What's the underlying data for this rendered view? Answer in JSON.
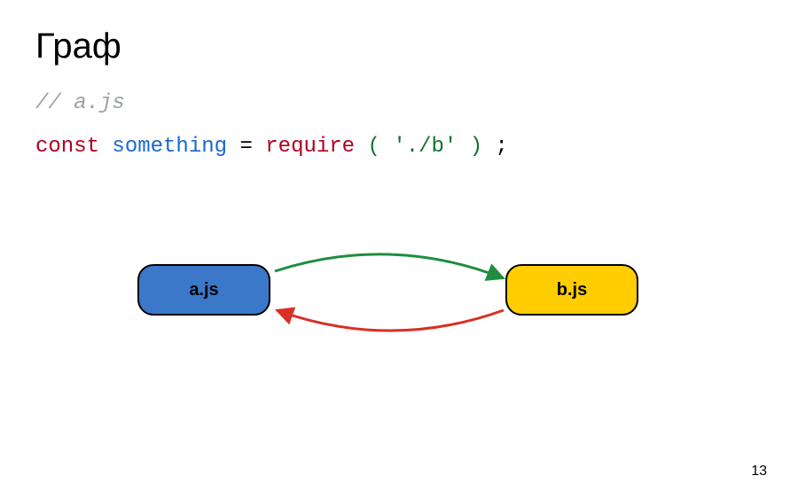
{
  "title": "Граф",
  "comment": "// a.js",
  "code": {
    "const": "const",
    "ident": "something",
    "eq": " = ",
    "fn": "require",
    "lparen": "(",
    "str": "'./b'",
    "rparen": ")",
    "semi": ";"
  },
  "nodes": {
    "a": "a.js",
    "b": "b.js"
  },
  "page_number": "13",
  "chart_data": {
    "type": "graph",
    "title": "Граф",
    "nodes": [
      {
        "id": "a.js",
        "color": "#3b78c9"
      },
      {
        "id": "b.js",
        "color": "#ffcd00"
      }
    ],
    "edges": [
      {
        "from": "a.js",
        "to": "b.js",
        "color": "#1e8e3e",
        "directed": true
      },
      {
        "from": "b.js",
        "to": "a.js",
        "color": "#d93025",
        "directed": true
      }
    ],
    "annotations": [
      "// a.js",
      "const something = require('./b');"
    ]
  }
}
